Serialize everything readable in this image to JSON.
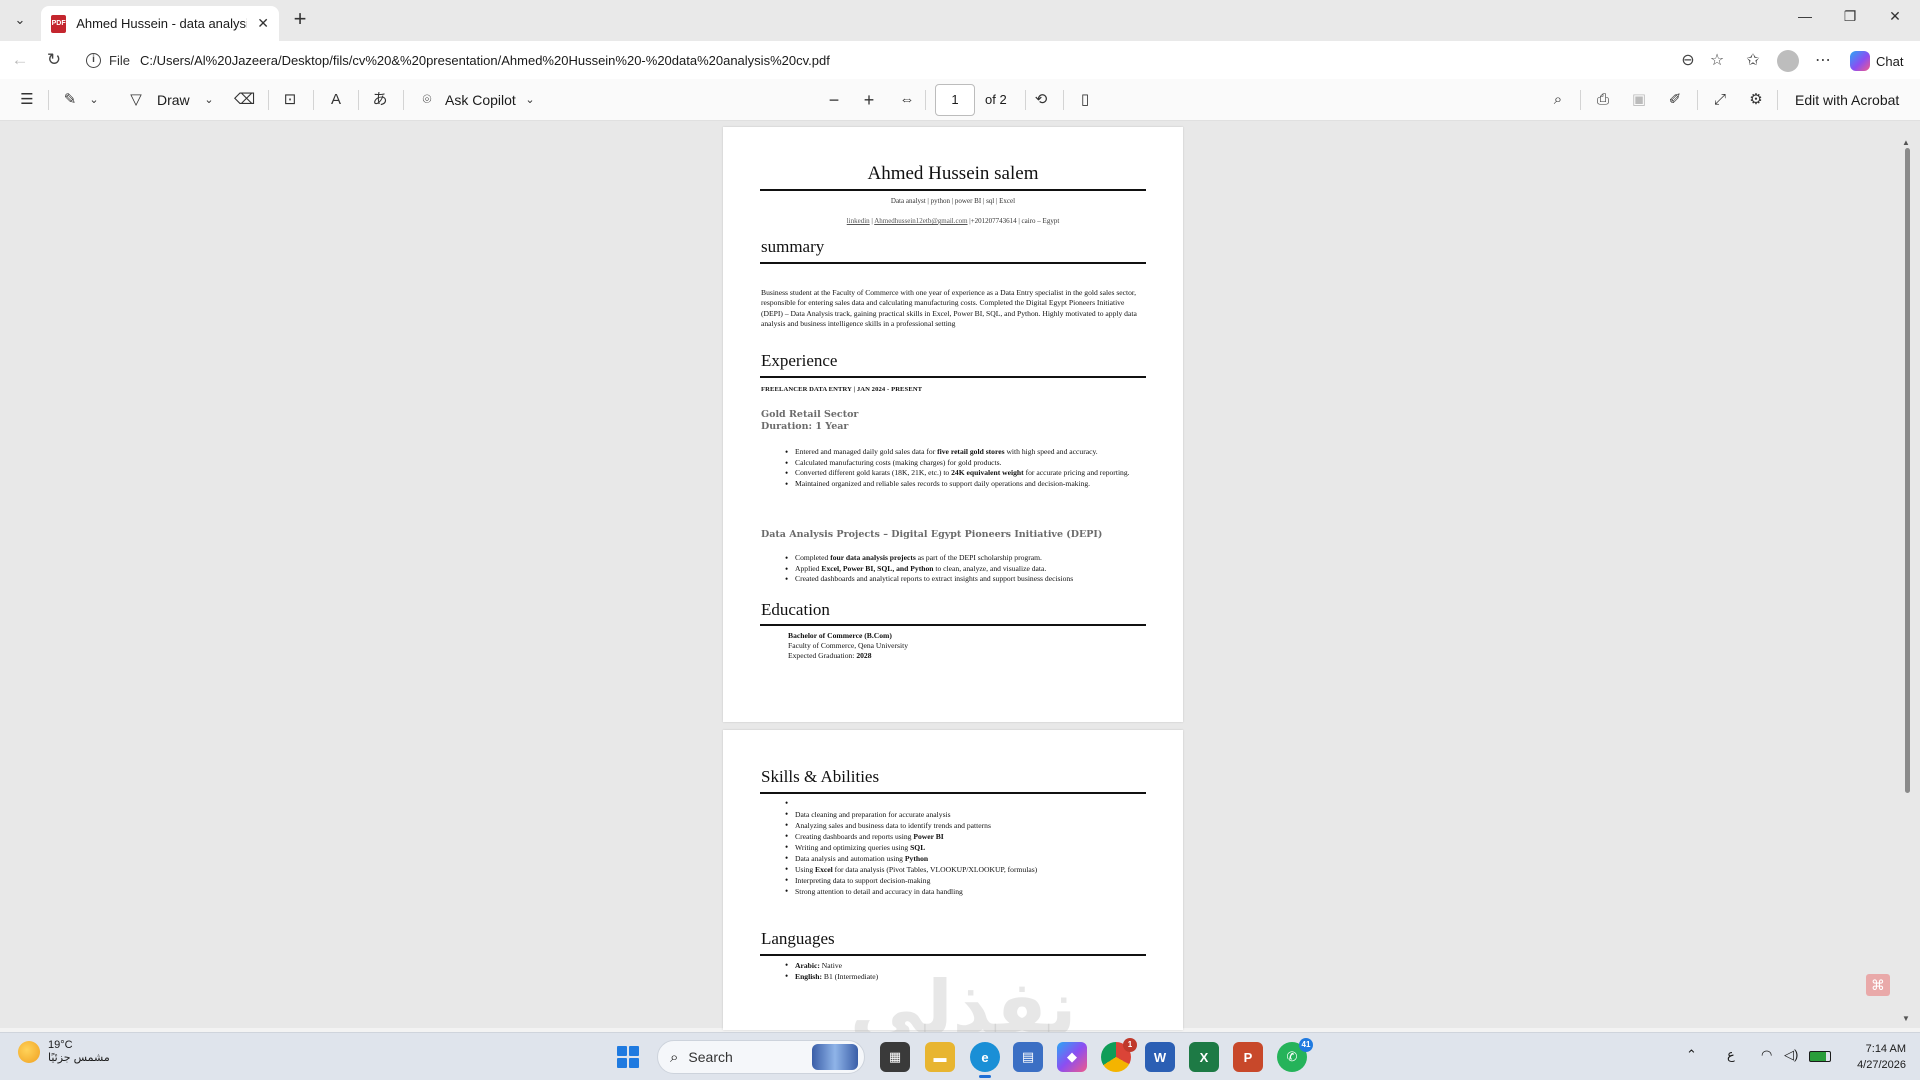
{
  "browser": {
    "tab_title": "Ahmed Hussein - data analysis cv.pdf",
    "url_prefix": "File",
    "url": "C:/Users/Al%20Jazeera/Desktop/fils/cv%20&%20presentation/Ahmed%20Hussein%20-%20data%20analysis%20cv.pdf",
    "chat_label": "Chat"
  },
  "pdf_toolbar": {
    "draw_label": "Draw",
    "copilot_label": "Ask Copilot",
    "page_current": "1",
    "page_total": "of 2",
    "edit_label": "Edit with Acrobat"
  },
  "cv": {
    "name": "Ahmed Hussein salem",
    "headline": "Data analyst | python | power BI | sql | Excel",
    "contact_linkedin": "linkedin",
    "contact_sep": " | ",
    "contact_email": "Ahmedhussein12etb@gmail.com",
    "contact_rest": " |+201207743614 | cairo – Egypt",
    "summary_title": "summary",
    "summary_text": "Business student at the Faculty of Commerce with one year of experience as a Data Entry specialist in the gold sales sector, responsible for entering sales data and calculating manufacturing costs. Completed the Digital Egypt Pioneers Initiative (DEPI) – Data Analysis track, gaining practical skills in Excel, Power BI, SQL, and Python. Highly motivated to apply data analysis and business intelligence skills in a professional setting",
    "experience_title": "Experience",
    "job_title": "FREELANCER DATA ENTRY  | JAN 2024 - PRESENT",
    "job_sector": "Gold Retail Sector",
    "job_duration": "Duration: 1 Year",
    "job_bullets": [
      {
        "pre": "Entered and managed daily gold sales data for ",
        "bold": "five retail gold stores",
        "post": " with high speed and accuracy."
      },
      {
        "pre": "Calculated manufacturing costs (making charges) for gold products.",
        "bold": "",
        "post": ""
      },
      {
        "pre": "Converted different gold karats (18K, 21K, etc.) to ",
        "bold": "24K equivalent weight",
        "post": " for accurate pricing and reporting."
      },
      {
        "pre": "Maintained organized and reliable sales records to support daily operations and decision-making.",
        "bold": "",
        "post": ""
      }
    ],
    "projects_title": "Data Analysis Projects – Digital Egypt Pioneers Initiative (DEPI)",
    "project_bullets": [
      {
        "pre": "Completed ",
        "bold": "four data analysis projects",
        "post": " as part of the DEPI scholarship program."
      },
      {
        "pre": "Applied ",
        "bold": "Excel, Power BI, SQL, and Python",
        "post": " to clean, analyze, and visualize data."
      },
      {
        "pre": "Created dashboards and analytical reports to extract insights and support business decisions",
        "bold": "",
        "post": ""
      }
    ],
    "education_title": "Education",
    "edu_degree": "Bachelor of Commerce (B.Com)",
    "edu_school": "Faculty of Commerce, Qena University",
    "edu_grad_label": "Expected Graduation: ",
    "edu_grad_year": "2028",
    "skills_title": "Skills & Abilities",
    "skills": [
      {
        "pre": "",
        "bold": "",
        "post": ""
      },
      {
        "pre": "Data cleaning and preparation for accurate analysis",
        "bold": "",
        "post": ""
      },
      {
        "pre": "Analyzing sales and business data to identify trends and patterns",
        "bold": "",
        "post": ""
      },
      {
        "pre": "Creating dashboards and reports using ",
        "bold": "Power BI",
        "post": ""
      },
      {
        "pre": "Writing and optimizing queries using ",
        "bold": "SQL",
        "post": ""
      },
      {
        "pre": "Data analysis and automation using ",
        "bold": "Python",
        "post": ""
      },
      {
        "pre": "Using ",
        "bold": "Excel",
        "post": " for data analysis (Pivot Tables, VLOOKUP/XLOOKUP, formulas)"
      },
      {
        "pre": "Interpreting data to support decision-making",
        "bold": "",
        "post": ""
      },
      {
        "pre": "Strong attention to detail and accuracy in data handling",
        "bold": "",
        "post": ""
      }
    ],
    "languages_title": "Languages",
    "languages": [
      {
        "pre": "",
        "bold": "Arabic:",
        "post": " Native"
      },
      {
        "pre": "",
        "bold": "English:",
        "post": " B1 (Intermediate)"
      }
    ]
  },
  "watermark": "نفذلي",
  "taskbar": {
    "weather_temp": "19°C",
    "weather_desc": "مشمس جزئيًا",
    "search_label": "Search",
    "whatsapp_badge": "41",
    "chrome_badge": "1",
    "lang": "ع",
    "time": "7:14 AM",
    "date": "4/27/2026"
  }
}
